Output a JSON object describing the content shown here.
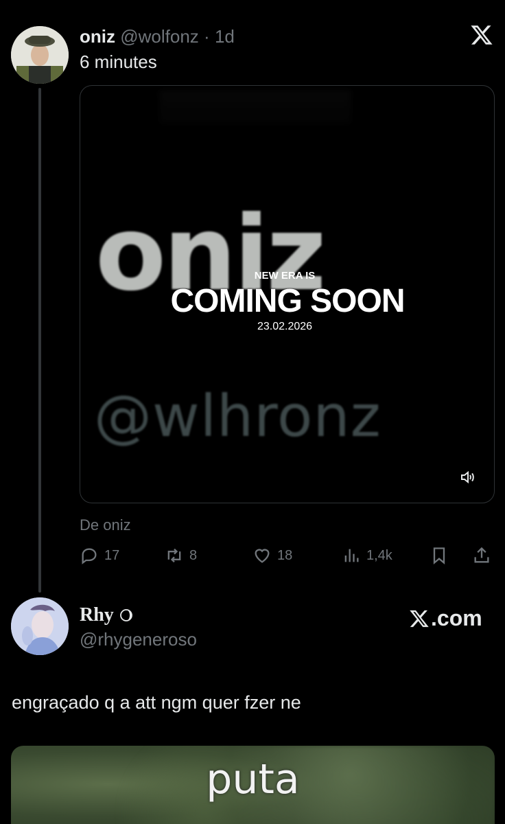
{
  "tweet": {
    "author_name": "oniz",
    "author_handle": "@wolfonz",
    "separator": "·",
    "age": "1d",
    "text": "6 minutes",
    "media": {
      "logo_word": "oniz",
      "overlay_line1": "NEW ERA IS",
      "overlay_line2": "COMING SOON",
      "overlay_date": "23.02.2026",
      "handle_text": "@wlhronz",
      "volume_icon": "volume-icon"
    },
    "source": "De oniz",
    "actions": {
      "replies": "17",
      "retweets": "8",
      "likes": "18",
      "views": "1,4k"
    }
  },
  "reply": {
    "author_name": "Rhy",
    "author_handle": "@rhygeneroso",
    "watermark": ".com",
    "text": "engraçado q a att ngm quer fzer ne",
    "media_caption": "puta"
  },
  "colors": {
    "background": "#000000",
    "text": "#e7e9ea",
    "muted": "#71767b",
    "border": "#2f3336"
  }
}
